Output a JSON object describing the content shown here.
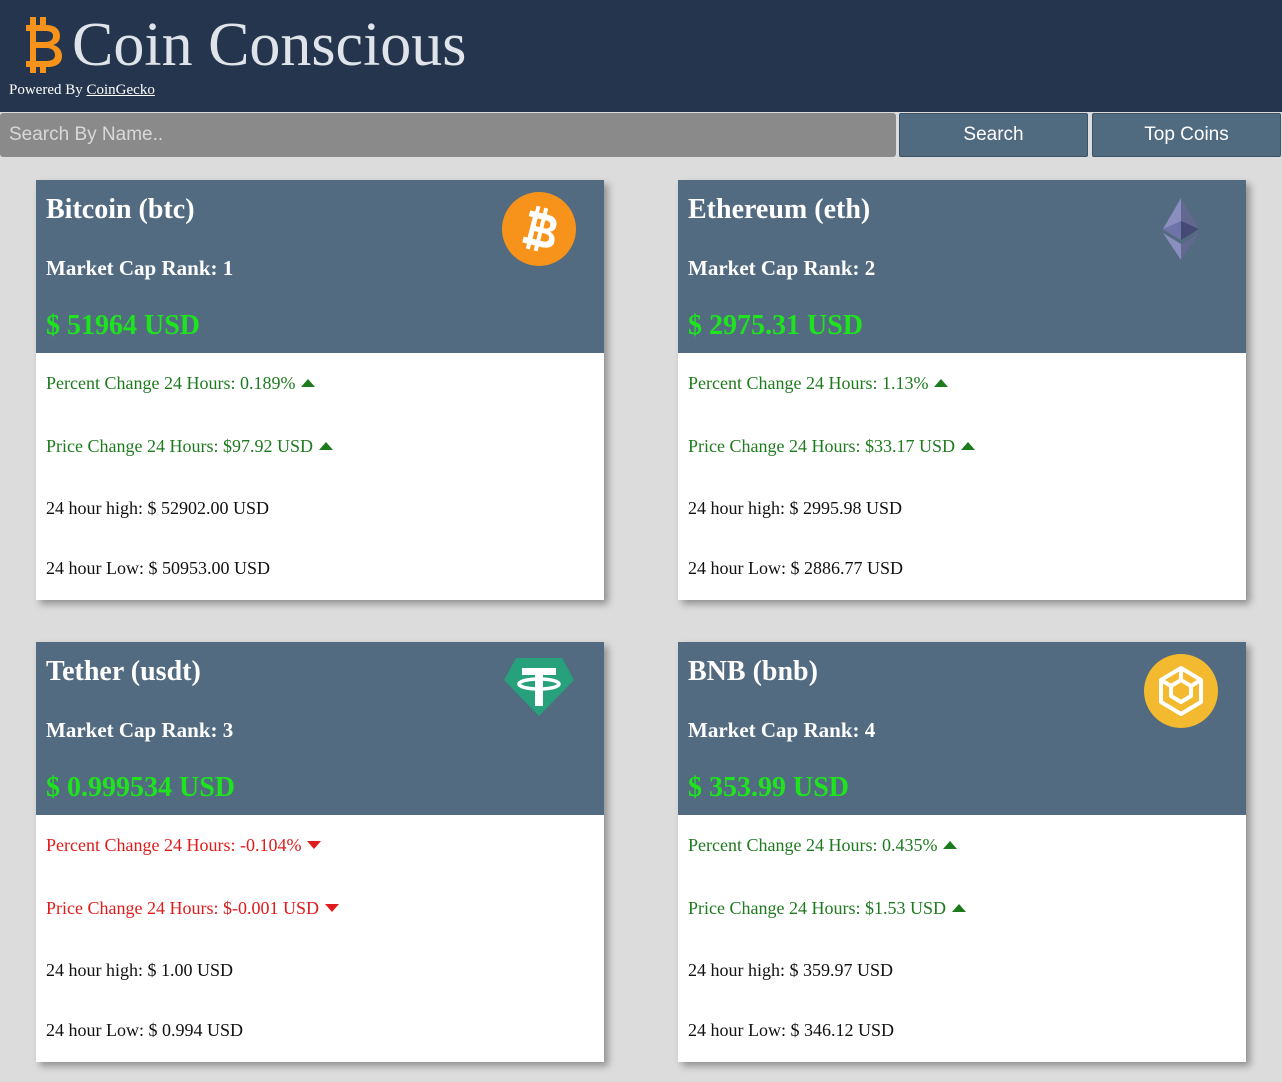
{
  "app": {
    "title": "Coin Conscious",
    "powered_prefix": "Powered By",
    "powered_link": "CoinGecko",
    "logo_icon": "bitcoin-b-icon",
    "accent_color": "#f7931a"
  },
  "search": {
    "placeholder": "Search By Name..",
    "value": "",
    "search_label": "Search",
    "top_label": "Top Coins"
  },
  "coins": [
    {
      "name": "Bitcoin (btc)",
      "rank": "Market Cap Rank: 1",
      "price": "$ 51964 USD",
      "pct": "Percent Change 24 Hours: 0.189%",
      "pct_dir": "up",
      "chg": "Price Change 24 Hours: $97.92 USD",
      "chg_dir": "up",
      "high": "24 hour high: $ 52902.00 USD",
      "low": "24 hour Low: $ 50953.00 USD",
      "icon": "bitcoin-icon"
    },
    {
      "name": "Ethereum (eth)",
      "rank": "Market Cap Rank: 2",
      "price": "$ 2975.31 USD",
      "pct": "Percent Change 24 Hours: 1.13%",
      "pct_dir": "up",
      "chg": "Price Change 24 Hours: $33.17 USD",
      "chg_dir": "up",
      "high": "24 hour high: $ 2995.98 USD",
      "low": "24 hour Low: $ 2886.77 USD",
      "icon": "ethereum-icon"
    },
    {
      "name": "Tether (usdt)",
      "rank": "Market Cap Rank: 3",
      "price": "$ 0.999534 USD",
      "pct": "Percent Change 24 Hours: -0.104%",
      "pct_dir": "down",
      "chg": "Price Change 24 Hours: $-0.001 USD",
      "chg_dir": "down",
      "high": "24 hour high: $ 1.00 USD",
      "low": "24 hour Low: $ 0.994 USD",
      "icon": "tether-icon"
    },
    {
      "name": "BNB (bnb)",
      "rank": "Market Cap Rank: 4",
      "price": "$ 353.99 USD",
      "pct": "Percent Change 24 Hours: 0.435%",
      "pct_dir": "up",
      "chg": "Price Change 24 Hours: $1.53 USD",
      "chg_dir": "up",
      "high": "24 hour high: $ 359.97 USD",
      "low": "24 hour Low: $ 346.12 USD",
      "icon": "bnb-icon"
    }
  ],
  "colors": {
    "header_bg": "#25354d",
    "card_head_bg": "#526b80",
    "price_green": "#1ee31e",
    "up_green": "#1e7a1e",
    "down_red": "#e01b1b"
  }
}
